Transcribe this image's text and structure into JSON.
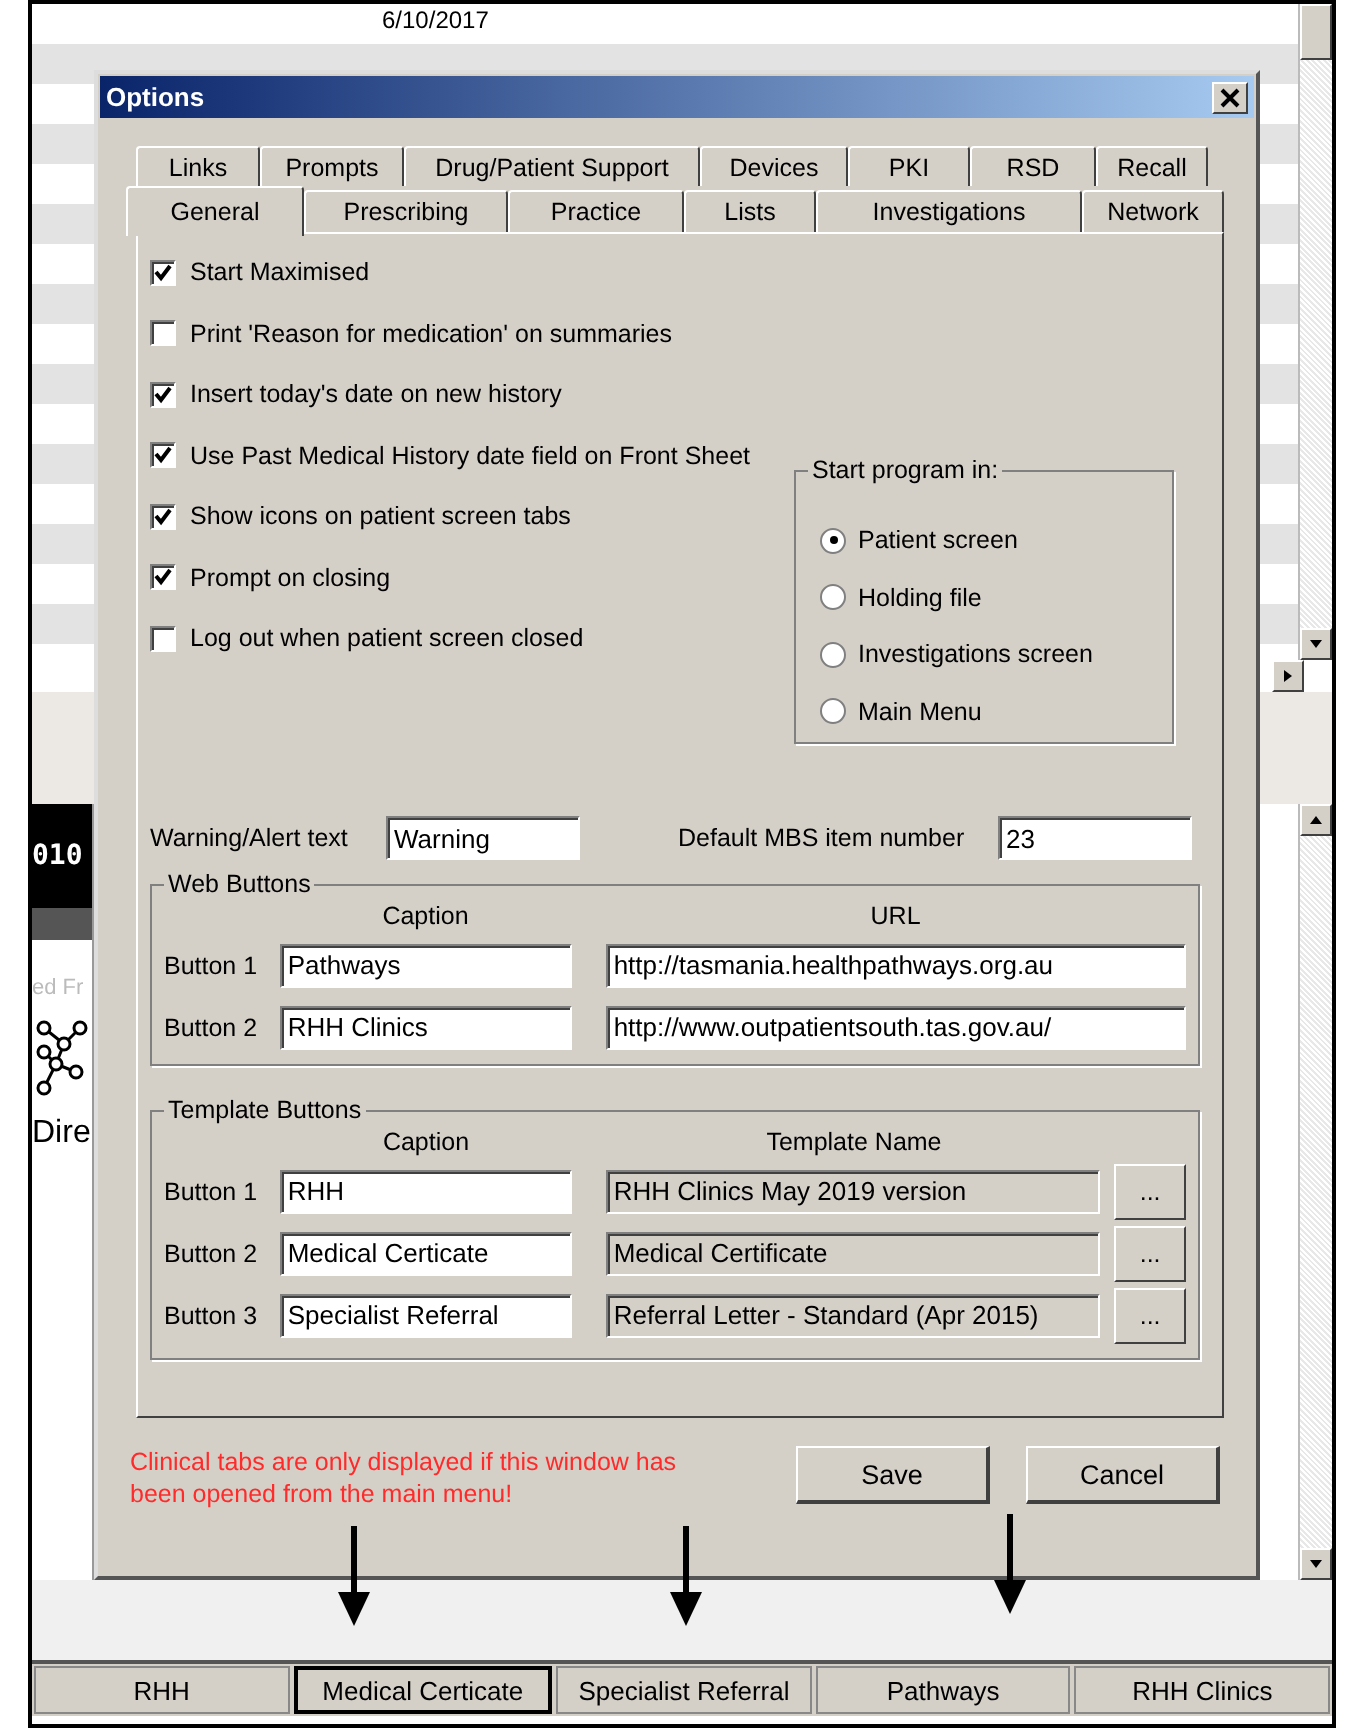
{
  "background_app": {
    "date": "6/10/2017",
    "band_text": "010",
    "faded_text": "ed Fr",
    "label_text": "Dire"
  },
  "dialog": {
    "title": "Options",
    "tab_rows": [
      [
        {
          "label": "Links",
          "selected": false
        },
        {
          "label": "Prompts",
          "selected": false
        },
        {
          "label": "Drug/Patient Support",
          "selected": false
        },
        {
          "label": "Devices",
          "selected": false
        },
        {
          "label": "PKI",
          "selected": false
        },
        {
          "label": "RSD",
          "selected": false
        },
        {
          "label": "Recall",
          "selected": false
        }
      ],
      [
        {
          "label": "General",
          "selected": true
        },
        {
          "label": "Prescribing",
          "selected": false
        },
        {
          "label": "Practice",
          "selected": false
        },
        {
          "label": "Lists",
          "selected": false
        },
        {
          "label": "Investigations",
          "selected": false
        },
        {
          "label": "Network",
          "selected": false
        }
      ]
    ],
    "checkboxes": [
      {
        "label": "Start Maximised",
        "checked": true
      },
      {
        "label": "Print 'Reason for medication' on summaries",
        "checked": false
      },
      {
        "label": "Insert today's date on new history",
        "checked": true
      },
      {
        "label": "Use Past Medical History date field on Front Sheet",
        "checked": true
      },
      {
        "label": "Show icons on patient screen tabs",
        "checked": true
      },
      {
        "label": "Prompt on closing",
        "checked": true
      },
      {
        "label": "Log out when patient screen closed",
        "checked": false
      }
    ],
    "start_program": {
      "title": "Start program in:",
      "options": [
        {
          "label": "Patient screen",
          "selected": true
        },
        {
          "label": "Holding file",
          "selected": false
        },
        {
          "label": "Investigations screen",
          "selected": false
        },
        {
          "label": "Main Menu",
          "selected": false
        }
      ]
    },
    "warning_text": {
      "label": "Warning/Alert text",
      "value": "Warning"
    },
    "default_mbs": {
      "label": "Default MBS item number",
      "value": "23"
    },
    "web_buttons": {
      "title": "Web Buttons",
      "columns": [
        "Caption",
        "URL"
      ],
      "rows": [
        {
          "label": "Button 1",
          "caption": "Pathways",
          "url": "http://tasmania.healthpathways.org.au"
        },
        {
          "label": "Button 2",
          "caption": "RHH Clinics",
          "url": "http://www.outpatientsouth.tas.gov.au/"
        }
      ]
    },
    "template_buttons": {
      "title": "Template Buttons",
      "columns": [
        "Caption",
        "Template Name"
      ],
      "rows": [
        {
          "label": "Button 1",
          "caption": "RHH",
          "template": "RHH Clinics May 2019 version",
          "browse": "..."
        },
        {
          "label": "Button 2",
          "caption": "Medical Certicate",
          "template": "Medical Certificate",
          "browse": "..."
        },
        {
          "label": "Button 3",
          "caption": "Specialist Referral",
          "template": "Referral Letter - Standard (Apr 2015)",
          "browse": "..."
        }
      ]
    },
    "note": "Clinical tabs are only displayed if this window has been opened from the main menu!",
    "buttons": [
      "Save",
      "Cancel"
    ]
  },
  "bottom_tabs": [
    {
      "label": "RHH",
      "selected": false
    },
    {
      "label": "Medical Certicate",
      "selected": true
    },
    {
      "label": "Specialist Referral",
      "selected": false
    },
    {
      "label": "Pathways",
      "selected": false
    },
    {
      "label": "RHH Clinics",
      "selected": false
    }
  ]
}
